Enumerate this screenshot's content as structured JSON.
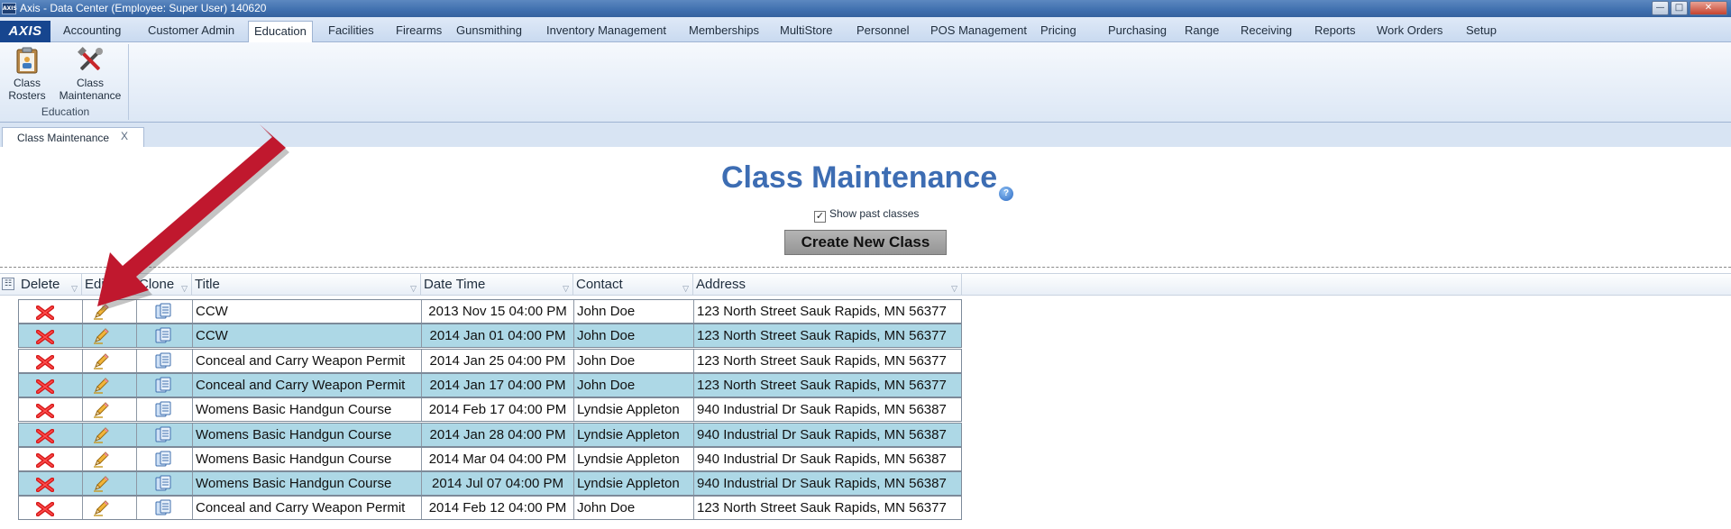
{
  "window": {
    "app_icon_text": "AXIS",
    "title": "Axis - Data Center  (Employee: Super User) 140620"
  },
  "menu": {
    "brand": "AXIS",
    "items": [
      "Accounting",
      "Customer Admin",
      "Education",
      "Facilities",
      "Firearms",
      "Gunsmithing",
      "Inventory Management",
      "Memberships",
      "MultiStore",
      "Personnel",
      "POS Management",
      "Pricing",
      "Purchasing",
      "Range",
      "Receiving",
      "Reports",
      "Work Orders",
      "Setup"
    ],
    "active": "Education"
  },
  "ribbon": {
    "buttons": [
      {
        "line1": "Class",
        "line2": "Rosters"
      },
      {
        "line1": "Class",
        "line2": "Maintenance"
      }
    ],
    "group_label": "Education"
  },
  "doc_tab": {
    "label": "Class Maintenance",
    "close": "X"
  },
  "page": {
    "title": "Class Maintenance",
    "help": "?",
    "show_past_label": "Show past classes",
    "show_past_checked": true,
    "create_button": "Create New Class"
  },
  "grid": {
    "columns": [
      "Delete",
      "Edit",
      "Clone",
      "Title",
      "Date Time",
      "Contact",
      "Address"
    ],
    "rows": [
      {
        "title": "CCW",
        "datetime": "2013 Nov 15 04:00 PM",
        "contact": "John Doe",
        "address": "123 North Street Sauk Rapids, MN 56377"
      },
      {
        "title": "CCW",
        "datetime": "2014 Jan 01 04:00 PM",
        "contact": "John Doe",
        "address": "123 North Street Sauk Rapids, MN 56377"
      },
      {
        "title": "Conceal and Carry Weapon Permit",
        "datetime": "2014 Jan 25 04:00 PM",
        "contact": "John Doe",
        "address": "123 North Street Sauk Rapids, MN 56377"
      },
      {
        "title": "Conceal and Carry Weapon Permit",
        "datetime": "2014 Jan 17 04:00 PM",
        "contact": "John Doe",
        "address": "123 North Street Sauk Rapids, MN 56377"
      },
      {
        "title": "Womens Basic Handgun Course",
        "datetime": "2014 Feb 17 04:00 PM",
        "contact": "Lyndsie Appleton",
        "address": "940 Industrial Dr Sauk Rapids, MN 56387"
      },
      {
        "title": "Womens Basic Handgun Course",
        "datetime": "2014 Jan 28 04:00 PM",
        "contact": "Lyndsie Appleton",
        "address": "940 Industrial Dr Sauk Rapids, MN 56387"
      },
      {
        "title": "Womens Basic Handgun Course",
        "datetime": "2014 Mar 04 04:00 PM",
        "contact": "Lyndsie Appleton",
        "address": "940 Industrial Dr Sauk Rapids, MN 56387"
      },
      {
        "title": "Womens Basic Handgun Course",
        "datetime": "2014 Jul 07 04:00 PM",
        "contact": "Lyndsie Appleton",
        "address": "940 Industrial Dr Sauk Rapids, MN 56387"
      },
      {
        "title": "Conceal and Carry Weapon Permit",
        "datetime": "2014 Feb 12 04:00 PM",
        "contact": "John Doe",
        "address": "123 North Street Sauk Rapids, MN 56377"
      }
    ]
  },
  "colors": {
    "accent": "#3d6db3",
    "row_alt": "#add8e6",
    "annotation_arrow": "#c0182e",
    "delete_icon": "#d61a1a"
  }
}
